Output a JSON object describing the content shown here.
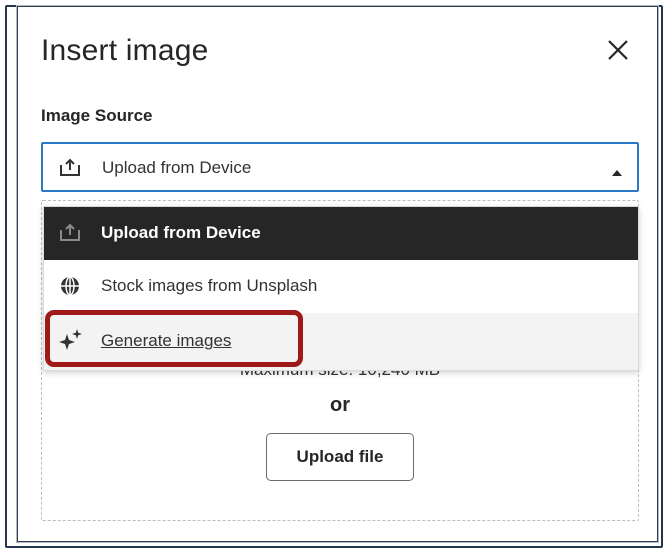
{
  "dialog": {
    "title": "Insert image",
    "close_icon": "close-icon"
  },
  "image_source": {
    "label": "Image Source",
    "selected_value": "Upload from Device",
    "options": [
      {
        "label": "Upload from Device",
        "icon": "upload-icon"
      },
      {
        "label": "Stock images from Unsplash",
        "icon": "globe-icon"
      },
      {
        "label": "Generate images",
        "icon": "sparkle-icon"
      }
    ]
  },
  "dropzone": {
    "max_size": "Maximum size: 10,240 MB",
    "or_text": "or",
    "upload_button": "Upload file"
  },
  "colors": {
    "accent": "#2a78c8",
    "highlight": "#a01919",
    "selected_option_bg": "#262626"
  }
}
